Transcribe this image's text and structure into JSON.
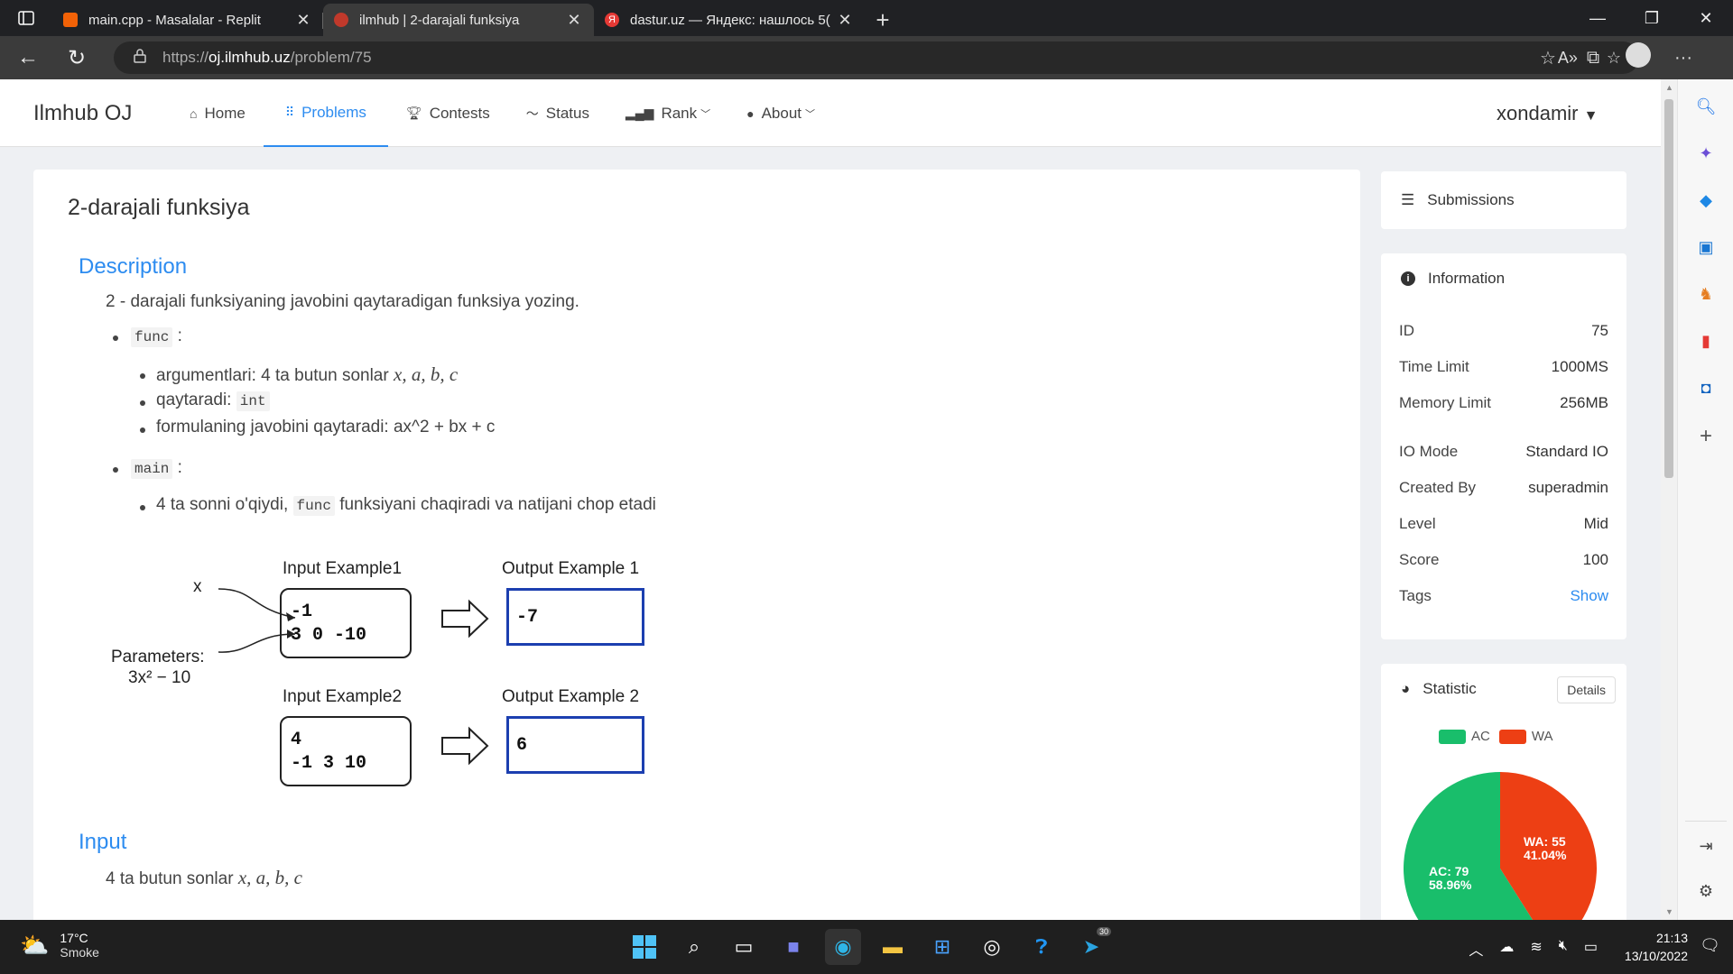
{
  "browser": {
    "tabs": [
      {
        "title": "main.cpp - Masalalar - Replit",
        "active": false
      },
      {
        "title": "ilmhub | 2-darajali funksiya",
        "active": true
      },
      {
        "title": "dastur.uz — Яндекс: нашлось 5(",
        "active": false
      }
    ],
    "url_prefix": "https://",
    "url_domain": "oj.ilmhub.uz",
    "url_path": "/problem/75"
  },
  "site": {
    "logo": "Ilmhub OJ",
    "nav": [
      {
        "label": "Home",
        "icon": "home-icon"
      },
      {
        "label": "Problems",
        "icon": "grid-icon",
        "active": true
      },
      {
        "label": "Contests",
        "icon": "trophy-icon"
      },
      {
        "label": "Status",
        "icon": "pulse-icon"
      },
      {
        "label": "Rank",
        "icon": "bar-chart-icon"
      },
      {
        "label": "About",
        "icon": "info-icon"
      }
    ],
    "user": "xondamir"
  },
  "problem": {
    "title": "2-darajali funksiya",
    "description_heading": "Description",
    "intro": "2 - darajali funksiyaning javobini qaytaradigan funksiya yozing.",
    "func_code": "func",
    "func_items": {
      "args_prefix": "argumentlari: 4 ta butun sonlar",
      "args_math": "x, a, b, c",
      "returns_prefix": "qaytaradi:",
      "returns_code": "int",
      "formula": "formulaning javobini qaytaradi: ax^2 + bx + c"
    },
    "main_code": "main",
    "main_item_prefix": "4 ta sonni o'qiydi,",
    "main_item_code": "func",
    "main_item_suffix": "funksiyani chaqiradi va natijani chop etadi",
    "diagram": {
      "x_label": "x",
      "params_label": "Parameters:",
      "params_formula": "3x² − 10",
      "input1_label": "Input Example1",
      "input1_lines": [
        "-1",
        "3 0 -10"
      ],
      "output1_label": "Output Example 1",
      "output1": "-7",
      "input2_label": "Input Example2",
      "input2_lines": [
        "4",
        "-1 3 10"
      ],
      "output2_label": "Output Example 2",
      "output2": "6"
    },
    "input_heading": "Input",
    "input_text": "4 ta butun sonlar",
    "input_math": "x, a, b, c"
  },
  "sidebar": {
    "submissions_label": "Submissions",
    "information_label": "Information",
    "info": [
      {
        "key": "ID",
        "value": "75"
      },
      {
        "key": "Time Limit",
        "value": "1000MS"
      },
      {
        "key": "Memory Limit",
        "value": "256MB"
      },
      {
        "key": "IO Mode",
        "value": "Standard IO"
      },
      {
        "key": "Created By",
        "value": "superadmin"
      },
      {
        "key": "Level",
        "value": "Mid"
      },
      {
        "key": "Score",
        "value": "100"
      },
      {
        "key": "Tags",
        "value": "Show"
      }
    ],
    "statistic_label": "Statistic",
    "details_button": "Details",
    "legend_ac": "AC",
    "legend_wa": "WA",
    "ac_label": "AC: 79",
    "ac_pct": "58.96%",
    "wa_label": "WA: 55",
    "wa_pct": "41.04%"
  },
  "chart_data": {
    "type": "pie",
    "categories": [
      "AC",
      "WA"
    ],
    "values": [
      79,
      55
    ],
    "colors": [
      "#19be6b",
      "#ed3f14"
    ]
  },
  "taskbar": {
    "temp": "17°C",
    "weather": "Smoke",
    "time": "21:13",
    "date": "13/10/2022",
    "telegram_badge": "30"
  }
}
